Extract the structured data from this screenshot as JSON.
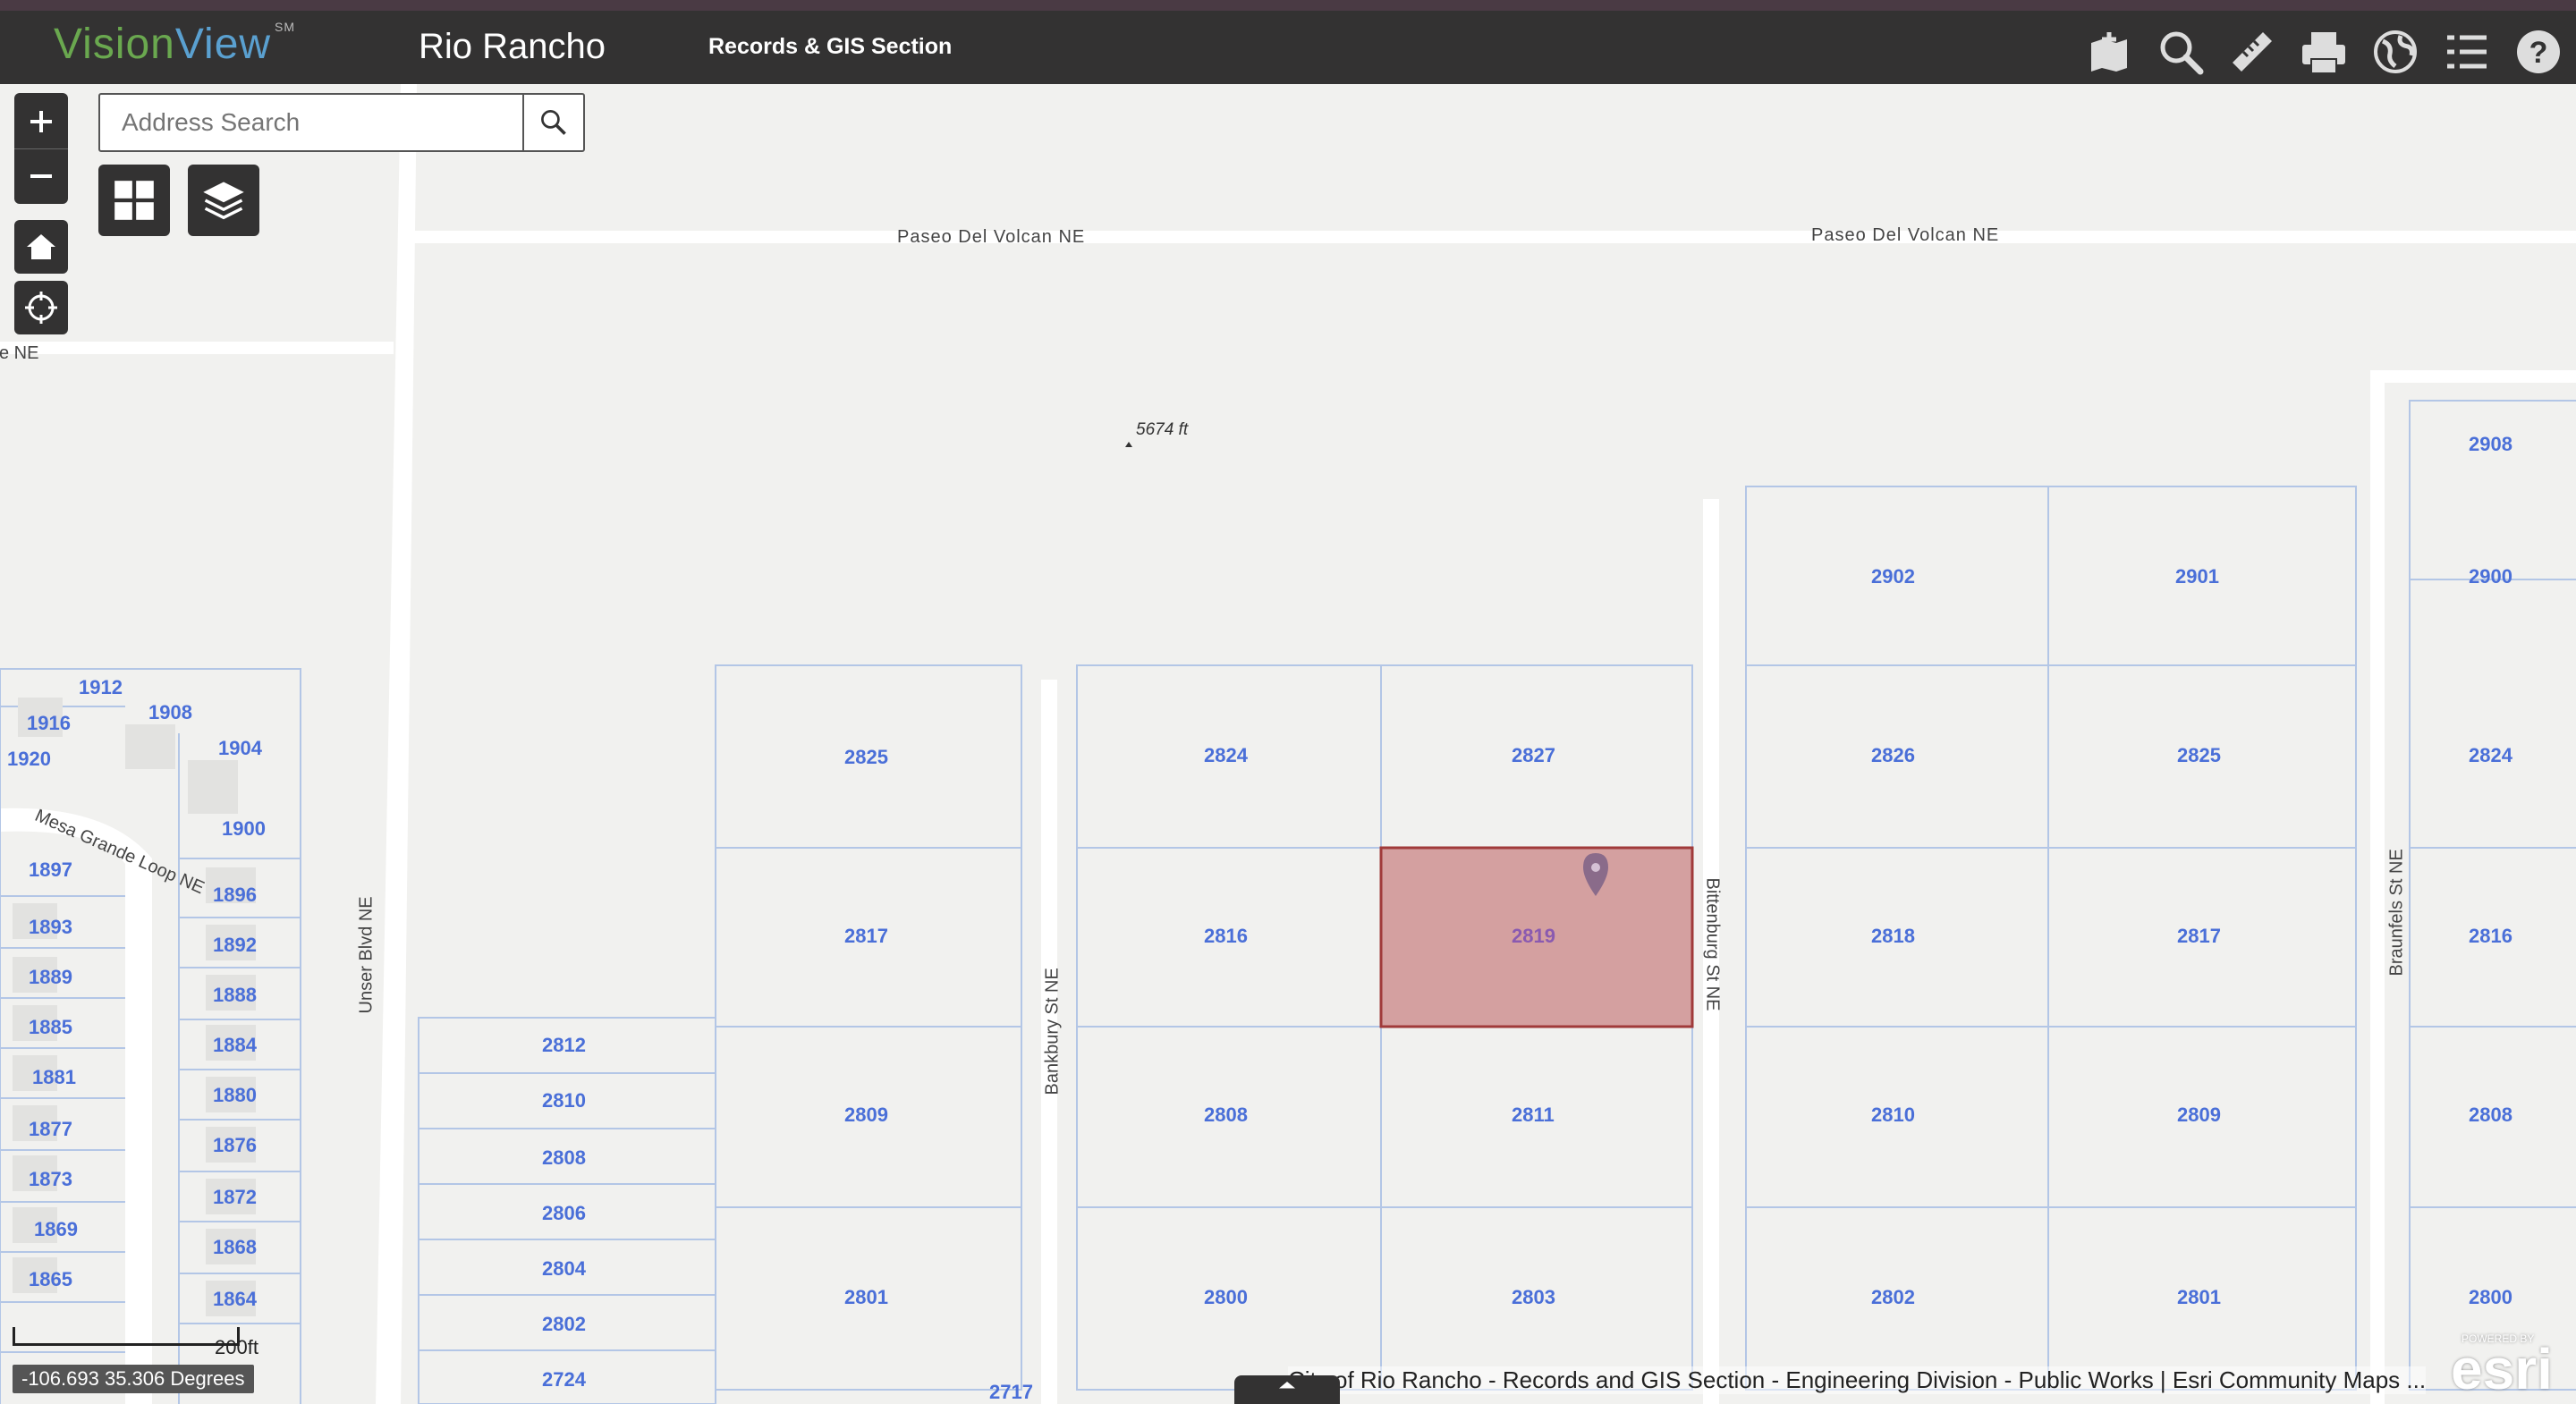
{
  "header": {
    "logo_vision": "Vision",
    "logo_view": "View",
    "logo_sm": "SM",
    "city": "Rio Rancho",
    "section": "Records & GIS Section",
    "tools": [
      "bookmark-icon",
      "search-icon",
      "measure-icon",
      "print-icon",
      "basemap-icon",
      "layer-list-icon",
      "help-icon"
    ]
  },
  "search": {
    "placeholder": "Address Search"
  },
  "map": {
    "streets": {
      "paseo1": "Paseo Del Volcan NE",
      "paseo2": "Paseo Del Volcan NE",
      "ave": "Ave NE",
      "unser": "Unser Blvd NE",
      "bankbury": "Bankbury St NE",
      "bittenburg": "Bittenburg St NE",
      "braunfels": "Braunfels St NE",
      "mesa": "Mesa Grande Loop NE"
    },
    "elevation": "5674 ft",
    "selected_parcel": "2819",
    "parcels": {
      "p2908": "2908",
      "p2902": "2902",
      "p2901": "2901",
      "p2900": "2900",
      "p2825a": "2825",
      "p2824a": "2824",
      "p2827": "2827",
      "p2826": "2826",
      "p2825b": "2825",
      "p2824b": "2824",
      "p2817a": "2817",
      "p2816a": "2816",
      "p2818": "2818",
      "p2817b": "2817",
      "p2816b": "2816",
      "p2809a": "2809",
      "p2808a": "2808",
      "p2811": "2811",
      "p2810a": "2810",
      "p2809b": "2809",
      "p2808b": "2808",
      "p2801a": "2801",
      "p2800a": "2800",
      "p2803": "2803",
      "p2802a": "2802",
      "p2801b": "2801",
      "p2800b": "2800",
      "p2812": "2812",
      "p2810": "2810",
      "p2808": "2808",
      "p2806": "2806",
      "p2804": "2804",
      "p2802": "2802",
      "p2724": "2724",
      "p2717": "2717",
      "p1912": "1912",
      "p1916": "1916",
      "p1908": "1908",
      "p1920": "1920",
      "p1904": "1904",
      "p1900": "1900",
      "p1897": "1897",
      "p1896": "1896",
      "p1893": "1893",
      "p1892": "1892",
      "p1889": "1889",
      "p1888": "1888",
      "p1885": "1885",
      "p1884": "1884",
      "p1881": "1881",
      "p1880": "1880",
      "p1877": "1877",
      "p1876": "1876",
      "p1873": "1873",
      "p1872": "1872",
      "p1869": "1869",
      "p1868": "1868",
      "p1865": "1865",
      "p1864": "1864"
    }
  },
  "footer": {
    "scale": "200ft",
    "coords": "-106.693 35.306 Degrees",
    "attribution": "City of Rio Rancho - Records and GIS Section - Engineering Division - Public Works | Esri Community Maps ...",
    "esri": "esri",
    "powered": "POWERED BY"
  }
}
